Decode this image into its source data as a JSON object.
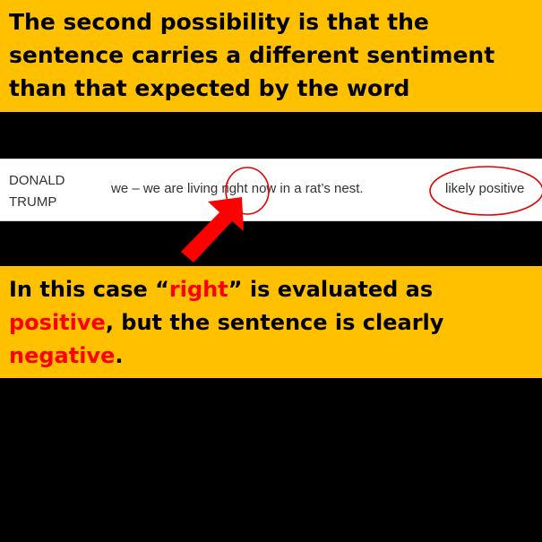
{
  "slide": {
    "heading_lines": [
      "The second possibility is that the",
      "sentence carries a different sentiment",
      "than that expected by the word"
    ],
    "explanation": {
      "part1": "In this case “",
      "word": "right",
      "part2": "” is evaluated as",
      "positive": "positive",
      "part3": ", but the sentence is clearly",
      "negative": "negative",
      "part4": "."
    }
  },
  "result_row": {
    "speaker_first": "DONALD",
    "speaker_last": "TRUMP",
    "quote": "we – we are living right now in a rat’s nest.",
    "verdict": "likely positive"
  },
  "colors": {
    "banner": "#FFC000",
    "background": "#000000",
    "highlight": "#FF0000",
    "row": "#FFFFFF"
  },
  "annotations": {
    "circles": [
      "highlight-circle-right",
      "highlight-circle-verdict"
    ],
    "arrow": "red-arrow-pointing-to-right"
  }
}
